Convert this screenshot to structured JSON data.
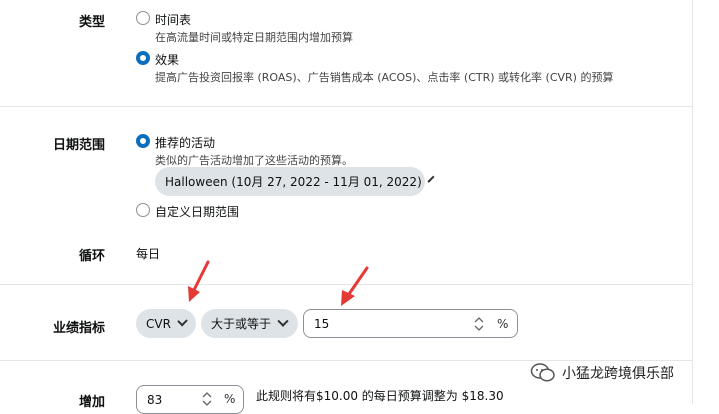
{
  "type_section": {
    "label": "类型",
    "options": [
      {
        "label": "时间表",
        "desc": "在高流量时间或特定日期范围内增加预算",
        "selected": false
      },
      {
        "label": "效果",
        "desc": "提高广告投资回报率 (ROAS)、广告销售成本 (ACOS)、点击率 (CTR) 或转化率 (CVR) 的预算",
        "selected": true
      }
    ]
  },
  "date_section": {
    "label": "日期范围",
    "recommended": {
      "label": "推荐的活动",
      "desc": "类似的广告活动增加了这些活动的预算。",
      "selected": true
    },
    "event_select": "Halloween (10月 27, 2022 - 11月 01, 2022)",
    "custom": {
      "label": "自定义日期范围",
      "selected": false
    }
  },
  "loop_section": {
    "label": "循环",
    "value": "每日"
  },
  "metric_section": {
    "label": "业绩指标",
    "metric_select": "CVR",
    "operator_select": "大于或等于",
    "threshold_value": "15",
    "unit": "%"
  },
  "increase_section": {
    "label": "增加",
    "value": "83",
    "unit": "%",
    "note": "此规则将有$10.00 的每日预算调整为 $18.30"
  },
  "watermark": {
    "text": "小猛龙跨境俱乐部"
  },
  "colors": {
    "radio_selected": "#0a6ebd",
    "arrow": "#e53935",
    "pill_bg": "#dee3e8"
  }
}
